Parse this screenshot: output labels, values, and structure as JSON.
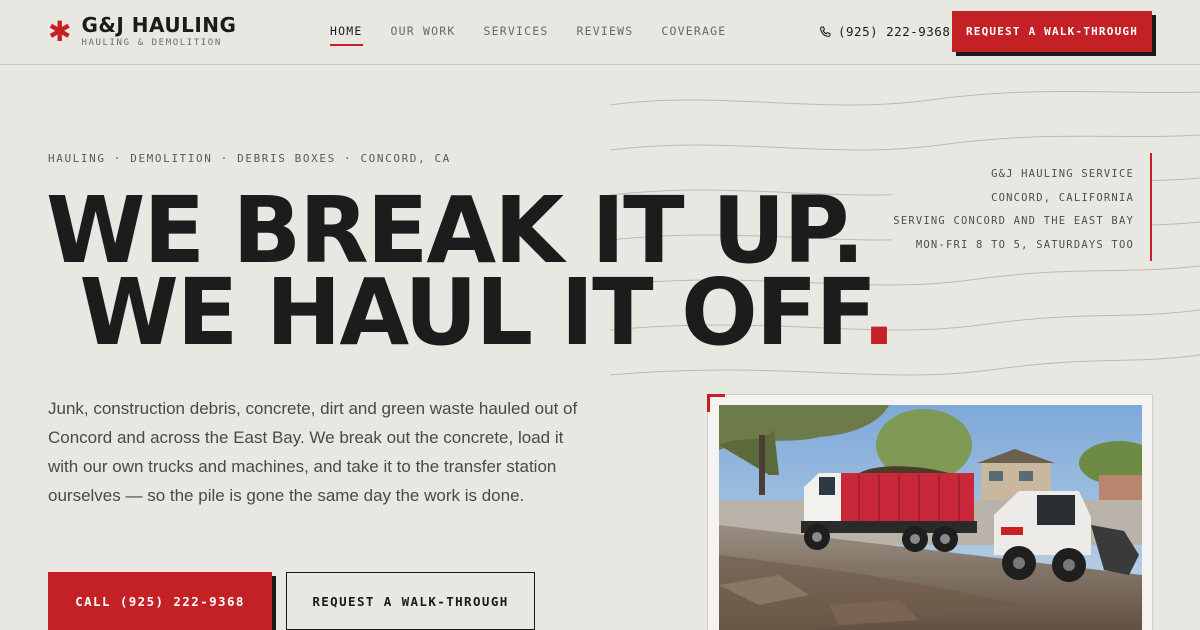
{
  "header": {
    "brand_name": "G&J HAULING",
    "brand_tagline": "HAULING & DEMOLITION",
    "nav": [
      {
        "label": "HOME",
        "active": true
      },
      {
        "label": "OUR WORK",
        "active": false
      },
      {
        "label": "SERVICES",
        "active": false
      },
      {
        "label": "REVIEWS",
        "active": false
      },
      {
        "label": "COVERAGE",
        "active": false
      }
    ],
    "phone": "(925) 222-9368",
    "cta": "REQUEST A WALK-THROUGH"
  },
  "hero": {
    "eyebrow": "HAULING · DEMOLITION · DEBRIS BOXES · CONCORD, CA",
    "headline_line1": "WE BREAK IT UP.",
    "headline_line2": "WE HAUL IT OFF",
    "headline_dot": ".",
    "body": "Junk, construction debris, concrete, dirt and green waste hauled out of Concord and across the East Bay. We break out the concrete, load it with our own trucks and machines, and take it to the transfer station ourselves — so the pile is gone the same day the work is done.",
    "primary_button": "CALL (925) 222-9368",
    "secondary_button": "REQUEST A WALK-THROUGH"
  },
  "info_card": {
    "lines": [
      "G&J HAULING SERVICE",
      "CONCORD, CALIFORNIA",
      "SERVING CONCORD AND THE EAST BAY",
      "MON-FRI 8 TO 5, SATURDAYS TOO"
    ]
  },
  "colors": {
    "accent": "#c32125",
    "background": "#e9e7e2",
    "ink": "#1b1b1b"
  },
  "icons": {
    "brand": "asterisk-icon",
    "phone": "phone-icon"
  }
}
